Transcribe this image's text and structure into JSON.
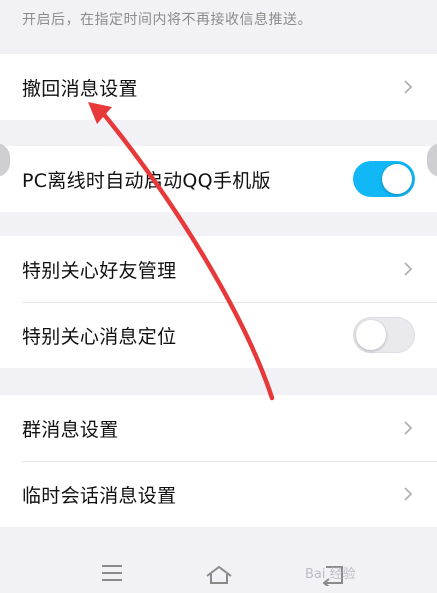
{
  "hint_text": "开启后，在指定时间内将不再接收信息推送。",
  "groups": [
    {
      "items": [
        {
          "label": "撤回消息设置",
          "control": "chevron"
        }
      ]
    },
    {
      "items": [
        {
          "label": "PC离线时自动启动QQ手机版",
          "control": "toggle",
          "on": true
        }
      ]
    },
    {
      "items": [
        {
          "label": "特别关心好友管理",
          "control": "chevron"
        },
        {
          "label": "特别关心消息定位",
          "control": "toggle",
          "on": false
        }
      ]
    },
    {
      "items": [
        {
          "label": "群消息设置",
          "control": "chevron"
        },
        {
          "label": "临时会话消息设置",
          "control": "chevron"
        }
      ]
    }
  ],
  "watermark": "Bai 经验",
  "colors": {
    "toggle_on": "#12b7f5",
    "arrow": "#e8393a",
    "background": "#f2f2f6"
  },
  "nav_icons": [
    "menu-icon",
    "home-icon",
    "back-icon"
  ]
}
